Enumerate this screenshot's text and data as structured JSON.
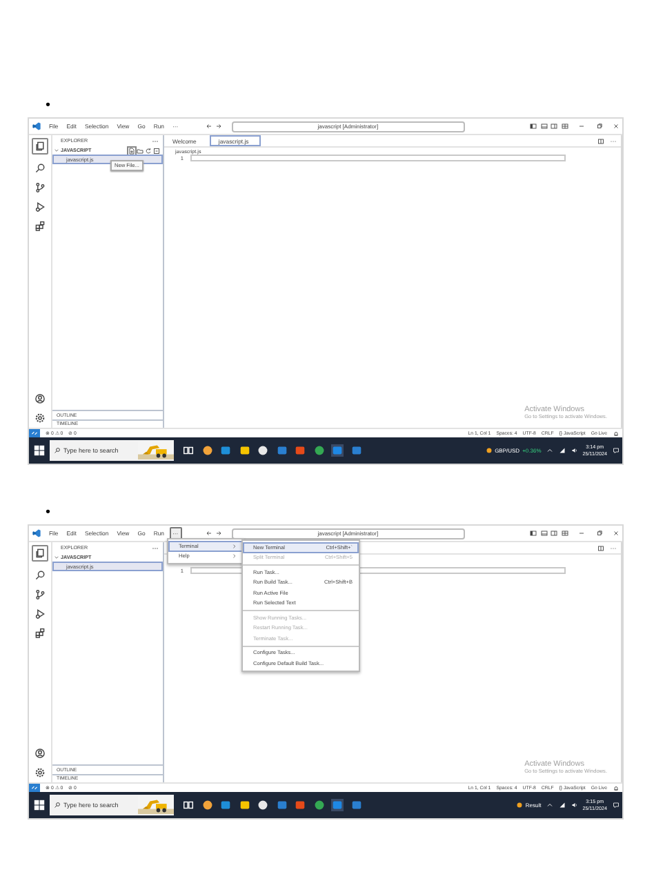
{
  "shots": [
    {
      "bullet": "•",
      "menu": [
        {
          "label": "File",
          "selected": false
        },
        {
          "label": "Edit",
          "selected": false
        },
        {
          "label": "Selection",
          "selected": false
        },
        {
          "label": "View",
          "selected": false
        },
        {
          "label": "Go",
          "selected": false
        },
        {
          "label": "Run",
          "selected": false
        },
        {
          "label": "···",
          "selected": false
        }
      ],
      "title": "javascript [Administrator]",
      "explorer": "EXPLORER",
      "folder": "JAVASCRIPT",
      "files": [
        {
          "name": "javascript.js",
          "selected": true
        }
      ],
      "tooltip": "New File...",
      "tabs": [
        {
          "label": "Welcome",
          "selected": false
        },
        {
          "label": "javascript.js",
          "selected": true
        }
      ],
      "breadcrumb": "javascript.js",
      "line_numbers": [
        "1"
      ],
      "panels": [
        "OUTLINE",
        "TIMELINE"
      ],
      "status_left": [
        "⊗ 0 ⚠ 0",
        "⊘ 0"
      ],
      "status_right": [
        "Ln 1, Col 1",
        "Spaces: 4",
        "UTF-8",
        "CRLF",
        "{} JavaScript",
        "Go Live"
      ],
      "watermark": {
        "title": "Activate Windows",
        "subtitle": "Go to Settings to activate Windows."
      },
      "taskbar": {
        "search": "Type here to search",
        "widget": "GBP/USD",
        "widget_change": "+0.36%",
        "time": "3:14 pm",
        "date": "25/11/2024"
      }
    },
    {
      "bullet": "•",
      "menu": [
        {
          "label": "File",
          "selected": false
        },
        {
          "label": "Edit",
          "selected": false
        },
        {
          "label": "Selection",
          "selected": false
        },
        {
          "label": "View",
          "selected": false
        },
        {
          "label": "Go",
          "selected": false
        },
        {
          "label": "Run",
          "selected": false
        },
        {
          "label": "···",
          "selected": true
        }
      ],
      "title": "javascript [Administrator]",
      "explorer": "EXPLORER",
      "folder": "JAVASCRIPT",
      "files": [
        {
          "name": "javascript.js",
          "selected": true
        }
      ],
      "line_numbers": [
        "1"
      ],
      "panels": [
        "OUTLINE",
        "TIMELINE"
      ],
      "overflow_menu": [
        {
          "label": "Terminal",
          "selected": true
        },
        {
          "label": "Help",
          "selected": false
        }
      ],
      "submenu": [
        {
          "kind": "item",
          "label": "New Terminal",
          "shortcut": "Ctrl+Shift+`",
          "disabled": false,
          "selected": true
        },
        {
          "kind": "item",
          "label": "Split Terminal",
          "shortcut": "Ctrl+Shift+5",
          "disabled": true,
          "selected": false
        },
        {
          "kind": "separator"
        },
        {
          "kind": "item",
          "label": "Run Task...",
          "disabled": false,
          "selected": false
        },
        {
          "kind": "item",
          "label": "Run Build Task...",
          "shortcut": "Ctrl+Shift+B",
          "disabled": false,
          "selected": false
        },
        {
          "kind": "item",
          "label": "Run Active File",
          "disabled": false,
          "selected": false
        },
        {
          "kind": "item",
          "label": "Run Selected Text",
          "disabled": false,
          "selected": false
        },
        {
          "kind": "separator"
        },
        {
          "kind": "item",
          "label": "Show Running Tasks...",
          "disabled": true,
          "selected": false
        },
        {
          "kind": "item",
          "label": "Restart Running Task...",
          "disabled": true,
          "selected": false
        },
        {
          "kind": "item",
          "label": "Terminate Task...",
          "disabled": true,
          "selected": false
        },
        {
          "kind": "separator"
        },
        {
          "kind": "item",
          "label": "Configure Tasks...",
          "disabled": false,
          "selected": false
        },
        {
          "kind": "item",
          "label": "Configure Default Build Task...",
          "disabled": false,
          "selected": false
        }
      ],
      "status_left": [
        "⊗ 0 ⚠ 0",
        "⊘ 0"
      ],
      "status_right": [
        "Ln 1, Col 1",
        "Spaces: 4",
        "UTF-8",
        "CRLF",
        "{} JavaScript",
        "Go Live"
      ],
      "watermark": {
        "title": "Activate Windows",
        "subtitle": "Go to Settings to activate Windows."
      },
      "taskbar": {
        "search": "Type here to search",
        "widget": "Result",
        "time": "3:15 pm",
        "date": "25/11/2024"
      }
    }
  ]
}
